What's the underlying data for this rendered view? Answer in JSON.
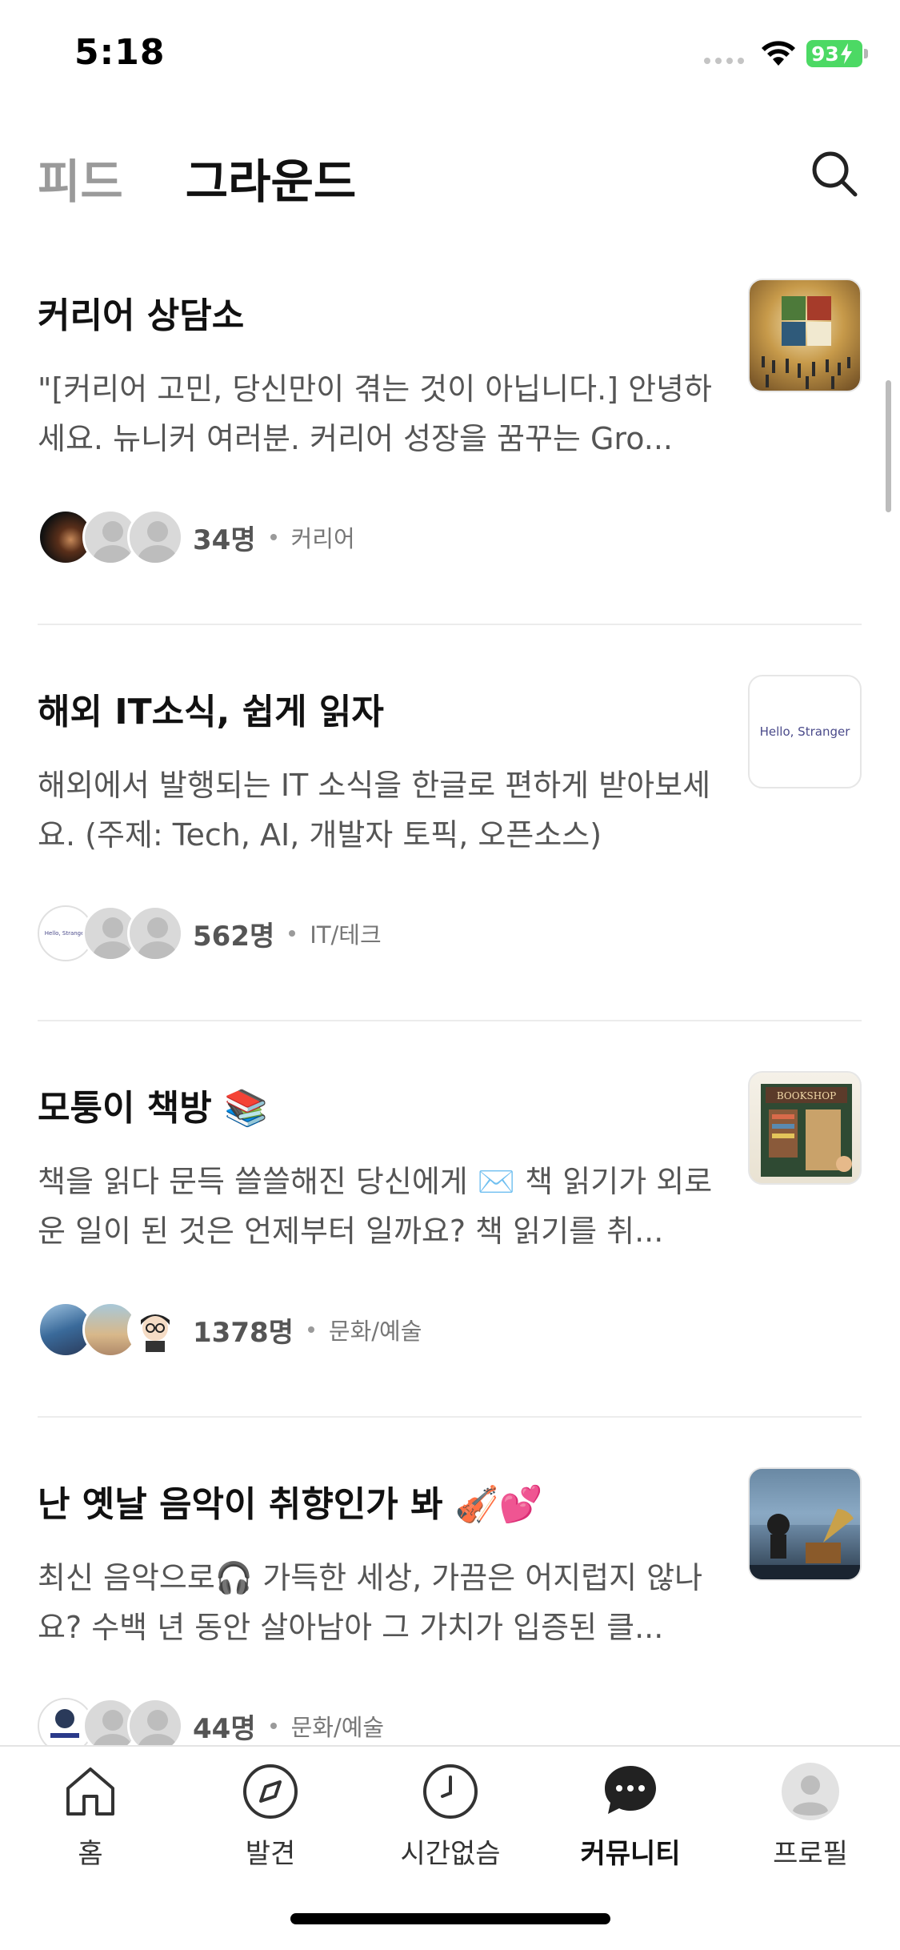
{
  "status_bar": {
    "time": "5:18",
    "battery": "93"
  },
  "header": {
    "tabs": [
      {
        "label": "피드",
        "active": false
      },
      {
        "label": "그라운드",
        "active": true
      }
    ]
  },
  "feed": [
    {
      "title": "커리어 상담소",
      "description": "\"[커리어 고민, 당신만이 겪는 것이 아닙니다.] 안녕하세요. 뉴니커 여러분. 커리어 성장을 꿈꾸는 Gro...",
      "members": "34명",
      "category": "커리어",
      "thumb": "puzzle-crowd-image"
    },
    {
      "title": "해외 IT소식, 쉽게 읽자",
      "description": "해외에서 발행되는 IT 소식을 한글로 편하게 받아보세요. (주제: Tech, AI, 개발자 토픽, 오픈소스)",
      "members": "562명",
      "category": "IT/테크",
      "thumb_text": "Hello, Stranger"
    },
    {
      "title": "모퉁이 책방 📚",
      "description": "책을 읽다 문득 쓸쓸해진 당신에게 ✉️ 책 읽기가 외로운 일이 된 것은 언제부터 일까요? 책 읽기를 취...",
      "members": "1378명",
      "category": "문화/예술",
      "thumb_text": "BOOKSHOP"
    },
    {
      "title": "난 옛날 음악이 취향인가 봐 🎻💕",
      "description": "최신 음악으로🎧 가득한 세상, 가끔은 어지럽지 않나요? 수백 년 동안 살아남아 그 가치가 입증된 클...",
      "members": "44명",
      "category": "문화/예술",
      "thumb": "gramophone-image"
    }
  ],
  "bottom_nav": [
    {
      "label": "홈",
      "icon": "home-icon",
      "active": false
    },
    {
      "label": "발견",
      "icon": "compass-icon",
      "active": false
    },
    {
      "label": "시간없슴",
      "icon": "clock-icon",
      "active": false
    },
    {
      "label": "커뮤니티",
      "icon": "chat-bubble-icon",
      "active": true
    },
    {
      "label": "프로필",
      "icon": "profile-icon",
      "active": false
    }
  ],
  "colors": {
    "accent": "#111111",
    "muted": "#9a9a9a",
    "battery": "#4cd964"
  }
}
